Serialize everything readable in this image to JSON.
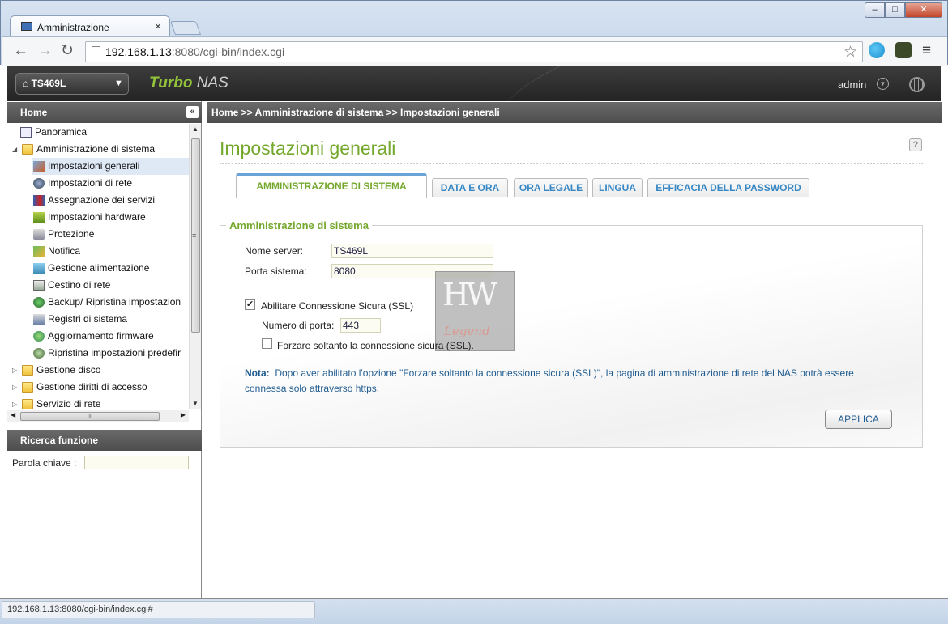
{
  "browser": {
    "tab_title": "Amministrazione",
    "tab_close": "×",
    "url_host": "192.168.1.13",
    "url_rest": ":8080/cgi-bin/index.cgi",
    "status_url": "192.168.1.13:8080/cgi-bin/index.cgi#"
  },
  "header": {
    "device_name": "TS469L",
    "brand_turbo": "Turbo",
    "brand_nas": "NAS",
    "user": "admin"
  },
  "sidebar": {
    "home_title": "Home",
    "tree": [
      {
        "label": "Panoramica",
        "icon": "overview-icon"
      },
      {
        "label": "Amministrazione di sistema",
        "icon": "folder-open-icon"
      },
      {
        "label": "Impostazioni generali",
        "icon": "general-settings-icon"
      },
      {
        "label": "Impostazioni di rete",
        "icon": "network-settings-icon"
      },
      {
        "label": "Assegnazione dei servizi",
        "icon": "service-binding-icon"
      },
      {
        "label": "Impostazioni hardware",
        "icon": "hardware-icon"
      },
      {
        "label": "Protezione",
        "icon": "security-icon"
      },
      {
        "label": "Notifica",
        "icon": "notification-icon"
      },
      {
        "label": "Gestione alimentazione",
        "icon": "power-icon"
      },
      {
        "label": "Cestino di rete",
        "icon": "recycle-bin-icon"
      },
      {
        "label": "Backup/ Ripristina impostazion",
        "icon": "backup-icon"
      },
      {
        "label": "Registri di sistema",
        "icon": "system-logs-icon"
      },
      {
        "label": "Aggiornamento firmware",
        "icon": "firmware-icon"
      },
      {
        "label": "Ripristina impostazioni predefir",
        "icon": "restore-defaults-icon"
      },
      {
        "label": "Gestione disco",
        "icon": "folder-icon"
      },
      {
        "label": "Gestione diritti di accesso",
        "icon": "folder-icon"
      },
      {
        "label": "Servizio di rete",
        "icon": "folder-icon"
      }
    ],
    "hscroll_grip": "III",
    "vscroll_grip": "≡",
    "search_title": "Ricerca funzione",
    "search_label": "Parola chiave :"
  },
  "main": {
    "breadcrumb": "Home >> Amministrazione di sistema >> Impostazioni generali",
    "page_title": "Impostazioni generali",
    "help": "?",
    "tabs": [
      "AMMINISTRAZIONE DI SISTEMA",
      "DATA E ORA",
      "ORA LEGALE",
      "LINGUA",
      "EFFICACIA DELLA PASSWORD"
    ],
    "section_title": "Amministrazione di sistema",
    "server_name_label": "Nome server:",
    "server_name_value": "TS469L",
    "system_port_label": "Porta sistema:",
    "system_port_value": "8080",
    "ssl_enable_label": "Abilitare Connessione Sicura (SSL)",
    "ssl_enable_checked": true,
    "port_number_label": "Numero di porta:",
    "port_number_value": "443",
    "force_ssl_label": "Forzare soltanto la connessione sicura (SSL).",
    "force_ssl_checked": false,
    "note_label": "Nota:",
    "note_text": "Dopo aver abilitato l'opzione \"Forzare soltanto la connessione sicura (SSL)\", la pagina di amministrazione di rete del NAS potrà essere connessa solo attraverso https.",
    "apply_label": "APPLICA"
  },
  "colors": {
    "accent_green": "#74a82c",
    "link_blue": "#3787c4"
  }
}
